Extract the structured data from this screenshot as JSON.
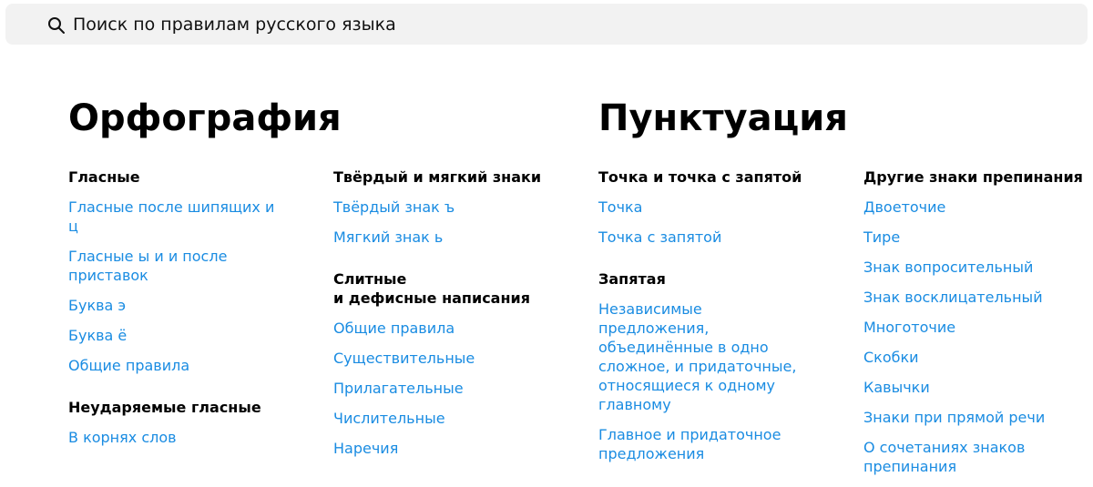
{
  "search": {
    "placeholder": "Поиск по правилам русского языка"
  },
  "colors": {
    "link": "#1a8ce2",
    "search_bg": "#f2f2f2",
    "text": "#000000"
  },
  "orthography": {
    "title": "Орфография",
    "col1": [
      {
        "title": [
          "Гласные"
        ],
        "links": [
          "Гласные после шипящих и ц",
          "Гласные ы и и после приставок",
          "Буква э",
          "Буква ё",
          "Общие правила"
        ]
      },
      {
        "title": [
          "Неударяемые гласные"
        ],
        "links": [
          "В корнях слов"
        ]
      }
    ],
    "col2": [
      {
        "title": [
          "Твёрдый и мягкий знаки"
        ],
        "links": [
          "Твёрдый знак ъ",
          "Мягкий знак ь"
        ]
      },
      {
        "title": [
          "Слитные",
          "и дефисные написания"
        ],
        "links": [
          "Общие правила",
          "Существительные",
          "Прилагательные",
          "Числительные",
          "Наречия"
        ]
      }
    ]
  },
  "punctuation": {
    "title": "Пунктуация",
    "col1": [
      {
        "title": [
          "Точка и точка с запятой"
        ],
        "links": [
          "Точка",
          "Точка с запятой"
        ]
      },
      {
        "title": [
          "Запятая"
        ],
        "links": [
          "Независимые предложения, объединённые в одно сложное, и придаточные, относящиеся к одному главному",
          "Главное и придаточное предложения"
        ]
      }
    ],
    "col2": [
      {
        "title": [
          "Другие знаки препинания"
        ],
        "links": [
          "Двоеточие",
          "Тире",
          "Знак вопросительный",
          "Знак восклицательный",
          "Многоточие",
          "Скобки",
          "Кавычки",
          "Знаки при прямой речи",
          "О сочетаниях знаков препинания"
        ]
      }
    ]
  }
}
